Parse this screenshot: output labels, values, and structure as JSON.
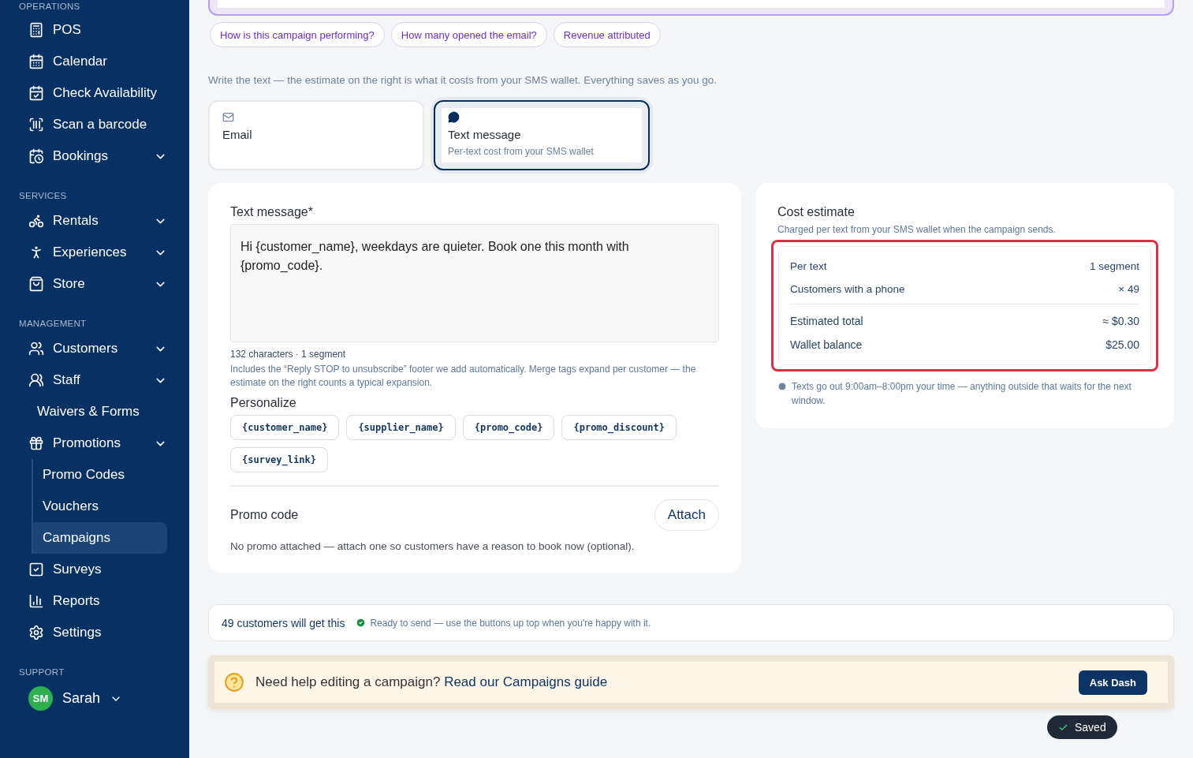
{
  "sidebar": {
    "sections": [
      {
        "title": "OPERATIONS",
        "items": [
          {
            "label": "POS",
            "has_menu": false,
            "selected": false
          },
          {
            "label": "Calendar",
            "has_menu": false,
            "selected": false
          },
          {
            "label": "Check Availability",
            "has_menu": false,
            "selected": false
          },
          {
            "label": "Scan a barcode",
            "has_menu": false,
            "selected": false
          },
          {
            "label": "Bookings",
            "has_menu": true,
            "selected": false
          }
        ]
      },
      {
        "title": "SERVICES",
        "items": [
          {
            "label": "Rentals",
            "has_menu": true,
            "selected": false
          },
          {
            "label": "Experiences",
            "has_menu": true,
            "selected": false
          },
          {
            "label": "Store",
            "has_menu": true,
            "selected": false
          }
        ]
      },
      {
        "title": "MANAGEMENT",
        "items": [
          {
            "label": "Customers",
            "has_menu": true,
            "selected": false
          },
          {
            "label": "Staff",
            "has_menu": true,
            "selected": false
          },
          {
            "label": "Waivers & Forms",
            "has_menu": false,
            "selected": false
          },
          {
            "label": "Promotions",
            "has_menu": true,
            "selected": false,
            "children": [
              {
                "label": "Promo Codes",
                "selected": false
              },
              {
                "label": "Vouchers",
                "selected": false
              },
              {
                "label": "Campaigns",
                "selected": true
              }
            ]
          },
          {
            "label": "Surveys",
            "has_menu": false,
            "selected": false
          },
          {
            "label": "Reports",
            "has_menu": false,
            "selected": false
          },
          {
            "label": "Settings",
            "has_menu": false,
            "selected": false
          }
        ]
      },
      {
        "title": "SUPPORT"
      }
    ],
    "user": {
      "initials": "SM",
      "name": "Sarah"
    }
  },
  "suggestions": [
    "How is this campaign performing?",
    "How many opened the email?",
    "Revenue attributed"
  ],
  "intro": "Write the text — the estimate on the right is what it costs from your SMS wallet. Everything saves as you go.",
  "channels": [
    {
      "label": "Email",
      "selected": false
    },
    {
      "label": "Text message",
      "note": "Per-text cost from your SMS wallet",
      "selected": true
    }
  ],
  "editor": {
    "label": "Text message*",
    "value": "Hi {customer_name}, weekdays are quieter. Book one this month with {promo_code}.",
    "characters": "132 characters",
    "separator": "·",
    "segments": "1 segment",
    "help": "Includes the “Reply STOP to unsubscribe” footer we add automatically. Merge tags expand per customer — the estimate on the right counts a typical expansion.",
    "personalize_title": "Personalize",
    "tags": [
      "{customer_name}",
      "{supplier_name}",
      "{promo_code}",
      "{promo_discount}",
      "{survey_link}"
    ],
    "promo_label": "Promo code",
    "attach": "Attach",
    "promo_note": "No promo attached — attach one so customers have a reason to book now (optional)."
  },
  "cost": {
    "title": "Cost estimate",
    "subtitle": "Charged per text from your SMS wallet when the campaign sends.",
    "rows": [
      {
        "kind": "item",
        "label": "Per text",
        "value": "1 segment"
      },
      {
        "kind": "item",
        "label": "Customers with a phone",
        "value": "× 49"
      },
      {
        "kind": "total",
        "label": "Estimated total",
        "value": "≈ $0.30"
      },
      {
        "kind": "total",
        "label": "Wallet balance",
        "value": "$25.00"
      }
    ],
    "note": "Texts go out 9:00am–8:00pm your time — anything outside that waits for the next window."
  },
  "status": {
    "count": "49 customers will get this",
    "ready": "Ready to send — use the buttons up top when you're happy with it."
  },
  "help": {
    "question": "Need help editing a campaign?",
    "link": "Read our Campaigns guide",
    "button": "Ask Dash"
  },
  "toast": "Saved"
}
